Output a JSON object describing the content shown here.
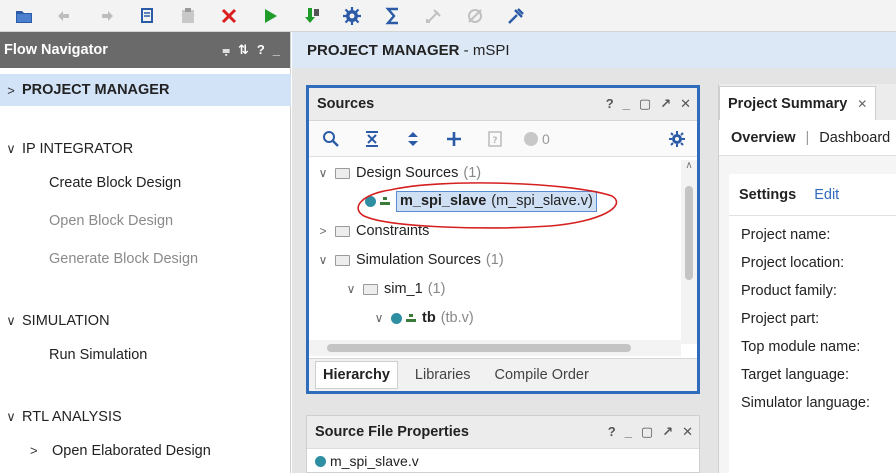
{
  "toolbar": {
    "icons": [
      "open-project-icon",
      "undo-icon",
      "redo-icon",
      "copy-icon",
      "paste-icon",
      "delete-icon",
      "run-icon",
      "program-icon",
      "settings-icon",
      "sigma-icon",
      "auto-connect-icon",
      "disconnect-icon",
      "debug-icon"
    ]
  },
  "flow_navigator": {
    "title": "Flow Navigator",
    "header_icons": [
      "⩦",
      "⇅",
      "?",
      "_"
    ],
    "sections": [
      {
        "label": "PROJECT MANAGER",
        "chevron": ">",
        "selected": true
      },
      {
        "label": "IP INTEGRATOR",
        "chevron": "∨"
      },
      {
        "label": "SIMULATION",
        "chevron": "∨"
      },
      {
        "label": "RTL ANALYSIS",
        "chevron": "∨"
      }
    ],
    "items": {
      "create_block": "Create Block Design",
      "open_block": "Open Block Design",
      "generate_block": "Generate Block Design",
      "run_sim": "Run Simulation",
      "open_elab": "Open Elaborated Design",
      "open_elab_chevron": ">"
    }
  },
  "main": {
    "title_bold": "PROJECT MANAGER",
    "title_rest": " - mSPI"
  },
  "sources": {
    "title": "Sources",
    "header_icons": [
      "?",
      "_",
      "▢",
      "↗",
      "✕"
    ],
    "count": "0",
    "tree": {
      "design_sources": "Design Sources",
      "design_sources_count": "(1)",
      "top_module": "m_spi_slave",
      "top_module_file": "(m_spi_slave.v)",
      "constraints": "Constraints",
      "sim_sources": "Simulation Sources",
      "sim_sources_count": "(1)",
      "sim_1": "sim_1",
      "sim_1_count": "(1)",
      "tb": "tb",
      "tb_file": "(tb.v)"
    },
    "tabs": [
      "Hierarchy",
      "Libraries",
      "Compile Order"
    ]
  },
  "source_file_properties": {
    "title": "Source File Properties",
    "file": "m_spi_slave.v"
  },
  "project_summary": {
    "tab": "Project Summary",
    "overview": "Overview",
    "dashboard": "Dashboard",
    "settings": "Settings",
    "edit": "Edit",
    "fields": [
      "Project name:",
      "Project location:",
      "Product family:",
      "Project part:",
      "Top module name:",
      "Target language:",
      "Simulator language:"
    ]
  },
  "colors": {
    "accent": "#2f6cbc",
    "selection": "#d2e3f8",
    "annotation": "#d62020"
  }
}
